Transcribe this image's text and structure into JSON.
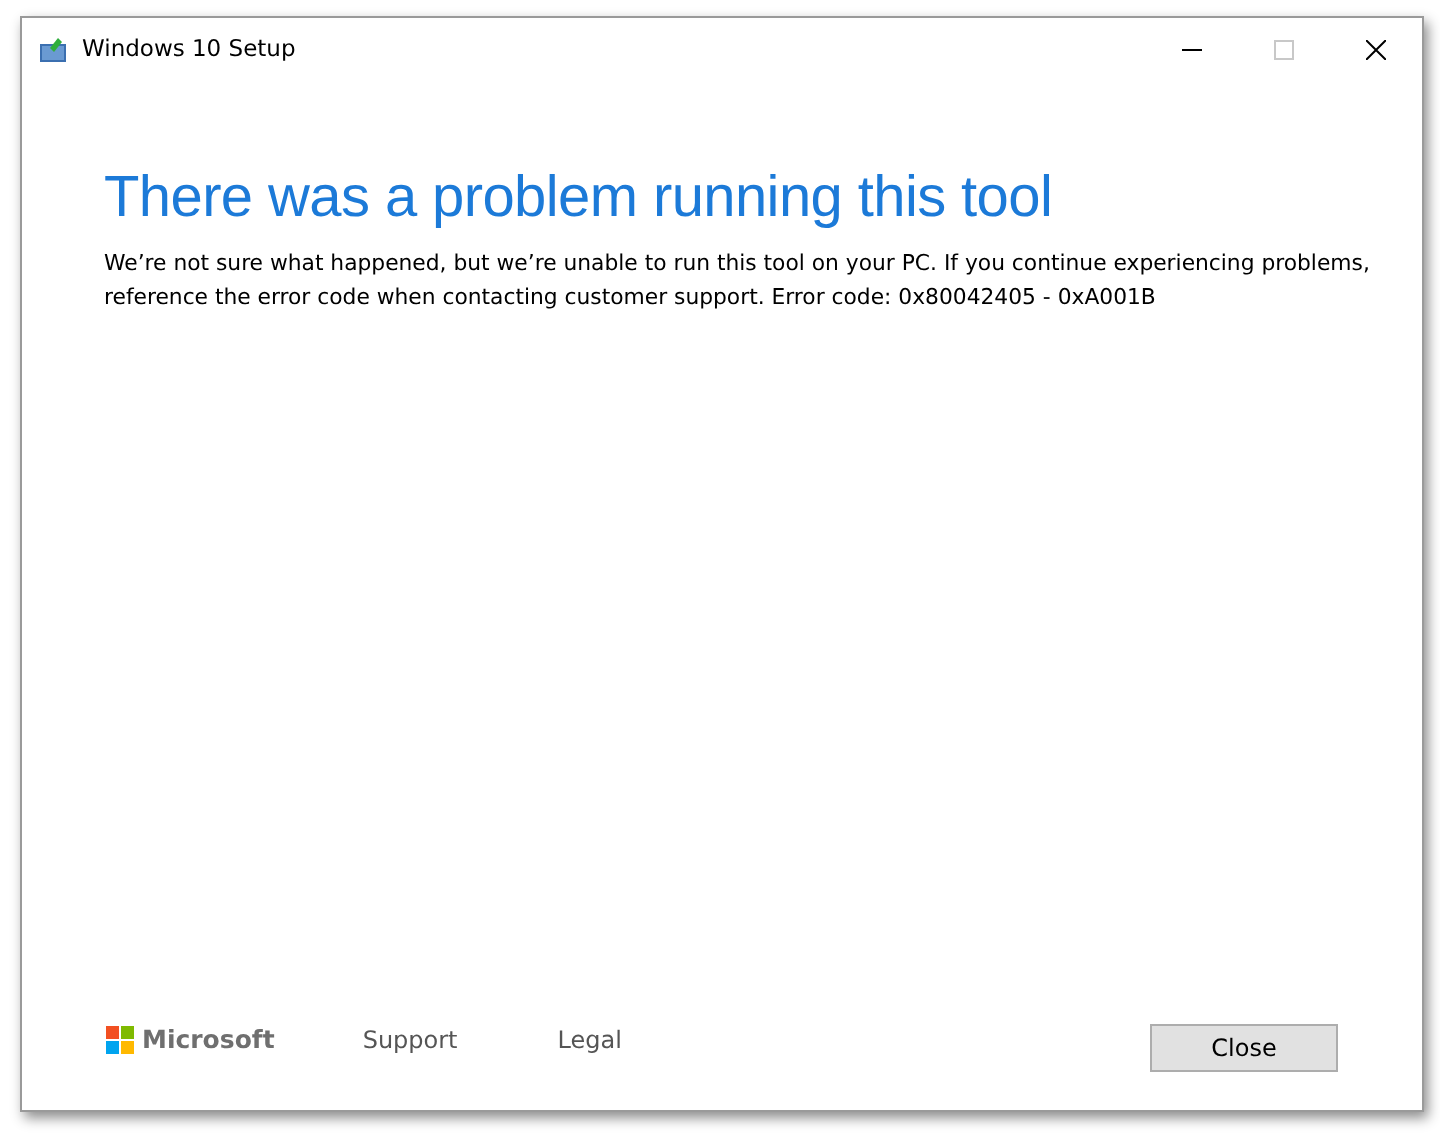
{
  "window": {
    "title": "Windows 10 Setup",
    "maximize": {
      "disabled": true
    }
  },
  "heading": "There was a problem running this tool",
  "message": "We’re not sure what happened, but we’re unable to run this tool on your PC. If you continue experiencing problems, reference the error code when contacting customer support. Error code: 0x80042405 - 0xA001B",
  "footer": {
    "brand": "Microsoft",
    "links": [
      "Support",
      "Legal"
    ]
  },
  "buttons": [
    "Close"
  ]
}
